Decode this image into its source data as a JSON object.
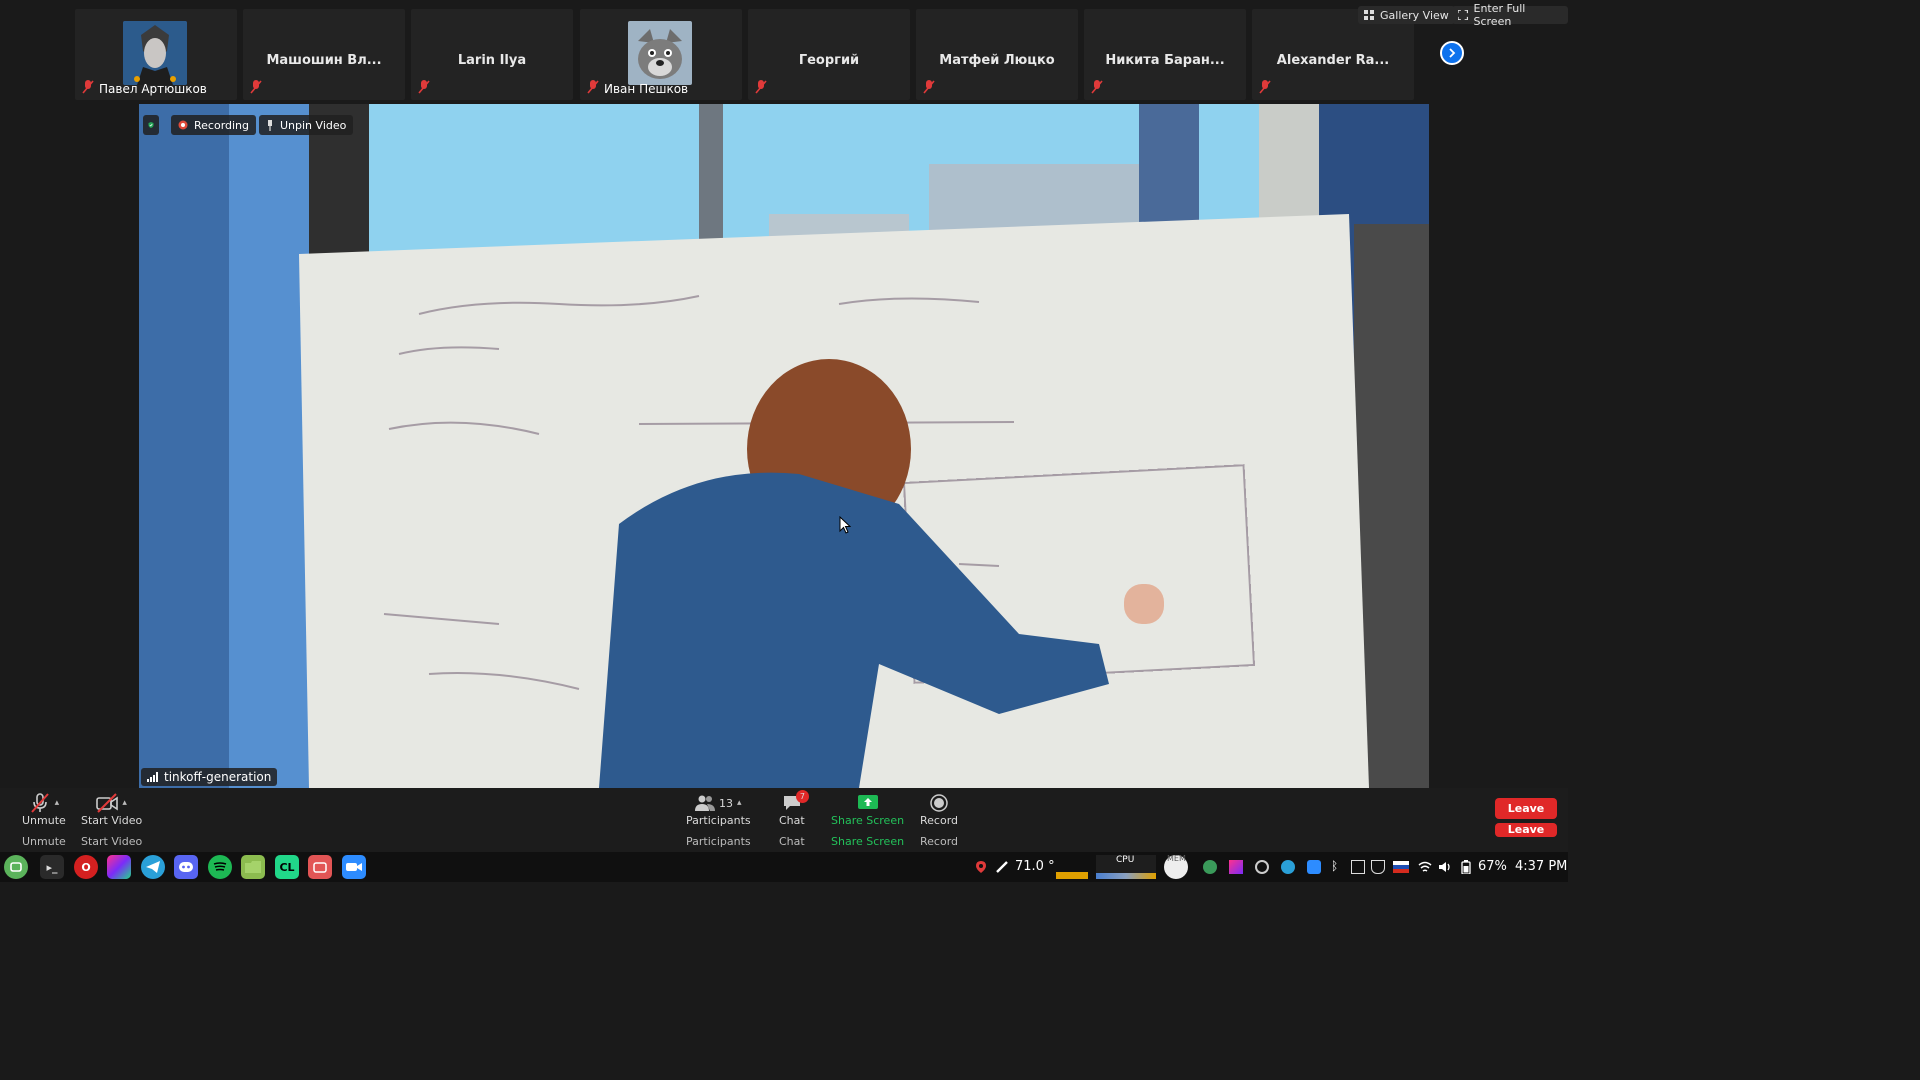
{
  "top_bar": {
    "gallery_view": "Gallery View",
    "enter_full_screen": "Enter Full Screen"
  },
  "participants": [
    {
      "name": "Павел Артюшков",
      "has_avatar": true,
      "avatar_icon": "cartoon-face-avatar",
      "muted": true
    },
    {
      "name": "Машошин Вл...",
      "has_avatar": false,
      "muted": true
    },
    {
      "name": "Larin Ilya",
      "has_avatar": false,
      "muted": true
    },
    {
      "name": "Иван Пешков",
      "has_avatar": true,
      "avatar_icon": "wolf-avatar",
      "muted": true
    },
    {
      "name": "Георгий",
      "has_avatar": false,
      "muted": true
    },
    {
      "name": "Матфей Люцко",
      "has_avatar": false,
      "muted": true
    },
    {
      "name": "Никита Баран...",
      "has_avatar": false,
      "muted": true
    },
    {
      "name": "Alexander Ra...",
      "has_avatar": false,
      "muted": true
    }
  ],
  "video": {
    "recording_label": "Recording",
    "unpin_label": "Unpin Video",
    "speaker_name": "tinkoff-generation"
  },
  "toolbar": {
    "unmute": "Unmute",
    "start_video": "Start Video",
    "participants_count": "13",
    "participants": "Participants",
    "chat": "Chat",
    "chat_badge": "7",
    "share_screen": "Share Screen",
    "record": "Record",
    "leave": "Leave"
  },
  "taskbar": {
    "temperature": "71.0 °",
    "cpu_label": "CPU",
    "mem_label": "MEM",
    "battery": "67%",
    "clock": "4:37 PM"
  },
  "colors": {
    "accent": "#0e72ed",
    "leave": "#e02828",
    "share_green": "#1db954",
    "mute_red": "#e03a3a"
  }
}
